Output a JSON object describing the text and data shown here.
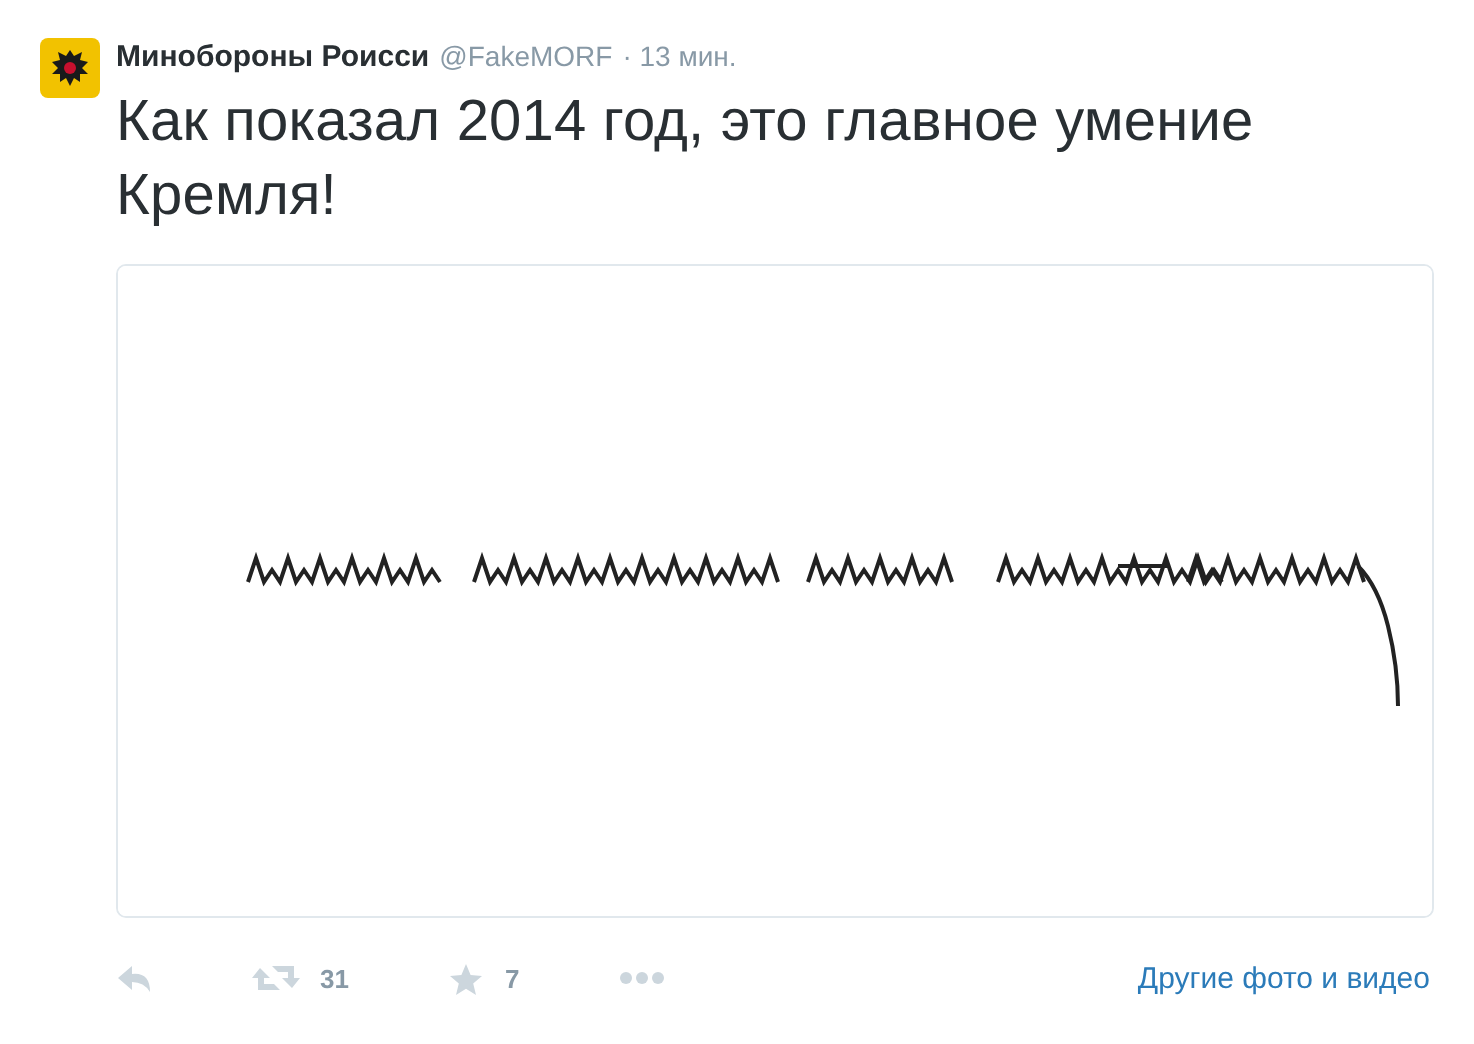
{
  "tweet": {
    "author": "Минобороны Роисси",
    "handle": "@FakeMORF",
    "time": "· 13 мин.",
    "text": "Как показал 2014 год, это главное умение Кремля!",
    "actions": [
      {
        "kind": "reply"
      },
      {
        "kind": "retweet",
        "count": "31"
      },
      {
        "kind": "favorite",
        "count": "7"
      },
      {
        "kind": "more"
      }
    ],
    "media_link": "Другие фото и видео"
  }
}
